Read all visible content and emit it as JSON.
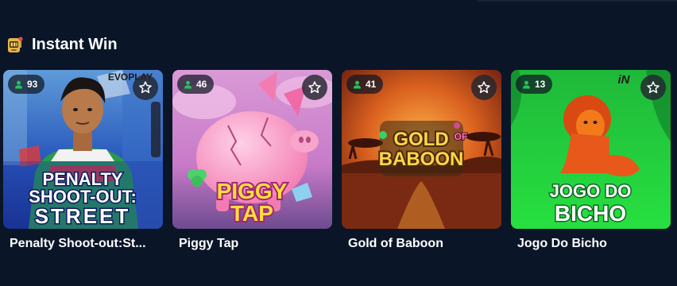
{
  "section": {
    "title": "Instant Win",
    "icon": "slot-machine-icon"
  },
  "games": [
    {
      "name": "Penalty Shoot-out:St...",
      "players": "93",
      "provider": "EVOPLAY",
      "art_lines": [
        "PENALTY",
        "SHOOT-OUT:",
        "STREET"
      ]
    },
    {
      "name": "Piggy Tap",
      "players": "46",
      "art_lines": [
        "PIGGY",
        "TAP"
      ]
    },
    {
      "name": "Gold of Baboon",
      "players": "41",
      "art_lines": [
        "GOLD",
        "OF",
        "BABOON"
      ]
    },
    {
      "name": "Jogo Do Bicho",
      "players": "13",
      "provider": "iN",
      "art_lines": [
        "JOGO DO",
        "BICHO"
      ]
    }
  ],
  "colors": {
    "background": "#0a1628",
    "players_icon": "#22c55e"
  }
}
